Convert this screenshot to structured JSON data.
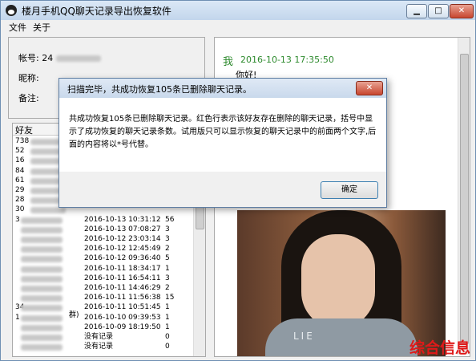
{
  "window": {
    "title": "楼月手机QQ聊天记录导出恢复软件",
    "min_glyph": "▁",
    "max_glyph": "□",
    "close_glyph": "✕"
  },
  "menu": {
    "file": "文件",
    "about": "关于"
  },
  "info": {
    "account_label": "帐号:",
    "account_value": "24",
    "nickname_label": "昵称:",
    "remark_label": "备注:"
  },
  "friends": {
    "header": "好友",
    "rows": [
      {
        "prefix": "738",
        "time": "",
        "count": ""
      },
      {
        "prefix": "52",
        "time": "",
        "count": ""
      },
      {
        "prefix": "16",
        "time": "",
        "count": ""
      },
      {
        "prefix": "84",
        "time": "",
        "count": ""
      },
      {
        "prefix": "61",
        "time": "",
        "count": ""
      },
      {
        "prefix": "29",
        "time": "",
        "count": ""
      },
      {
        "prefix": "28",
        "time": "",
        "count": ""
      },
      {
        "prefix": "30",
        "time": "",
        "count": ""
      },
      {
        "prefix": "3",
        "time": "2016-10-13 10:31:12",
        "count": "56"
      },
      {
        "prefix": "",
        "time": "2016-10-13 07:08:27",
        "count": "3"
      },
      {
        "prefix": "",
        "time": "2016-10-12 23:03:14",
        "count": "3"
      },
      {
        "prefix": "",
        "time": "2016-10-12 12:45:49",
        "count": "2"
      },
      {
        "prefix": "",
        "time": "2016-10-12 09:36:40",
        "count": "5"
      },
      {
        "prefix": "",
        "time": "2016-10-11 18:34:17",
        "count": "1"
      },
      {
        "prefix": "",
        "time": "2016-10-11 16:54:11",
        "count": "3"
      },
      {
        "prefix": "",
        "time": "2016-10-11 14:46:29",
        "count": "2"
      },
      {
        "prefix": "",
        "time": "2016-10-11 11:56:38",
        "count": "15"
      },
      {
        "prefix": "34",
        "time": "2016-10-11 10:51:45",
        "count": "1"
      },
      {
        "prefix": "1",
        "time": "2016-10-10 09:39:53",
        "count": "1"
      },
      {
        "prefix": "",
        "time": "2016-10-09 18:19:50",
        "count": "1"
      },
      {
        "prefix": "",
        "time": "没有记录",
        "count": "0"
      },
      {
        "prefix": "",
        "time": "没有记录",
        "count": "0"
      }
    ],
    "tag_text": "群)"
  },
  "chat": {
    "sender": "我",
    "timestamp": "2016-10-13 17:35:50",
    "message": "你好!",
    "shirt_text": "LIE"
  },
  "dialog": {
    "title": "扫描完毕，共成功恢复105条已删除聊天记录。",
    "close_glyph": "✕",
    "message": "共成功恢复105条已删除聊天记录。红色行表示该好友存在删除的聊天记录，括号中显示了成功恢复的聊天记录条数。试用版只可以显示恢复的聊天记录中的前面两个文字,后面的内容将以*号代替。",
    "ok_label": "确定"
  },
  "watermark": "综合信息",
  "colors": {
    "chat_green": "#2d8a2d",
    "watermark_red": "#e01919"
  }
}
